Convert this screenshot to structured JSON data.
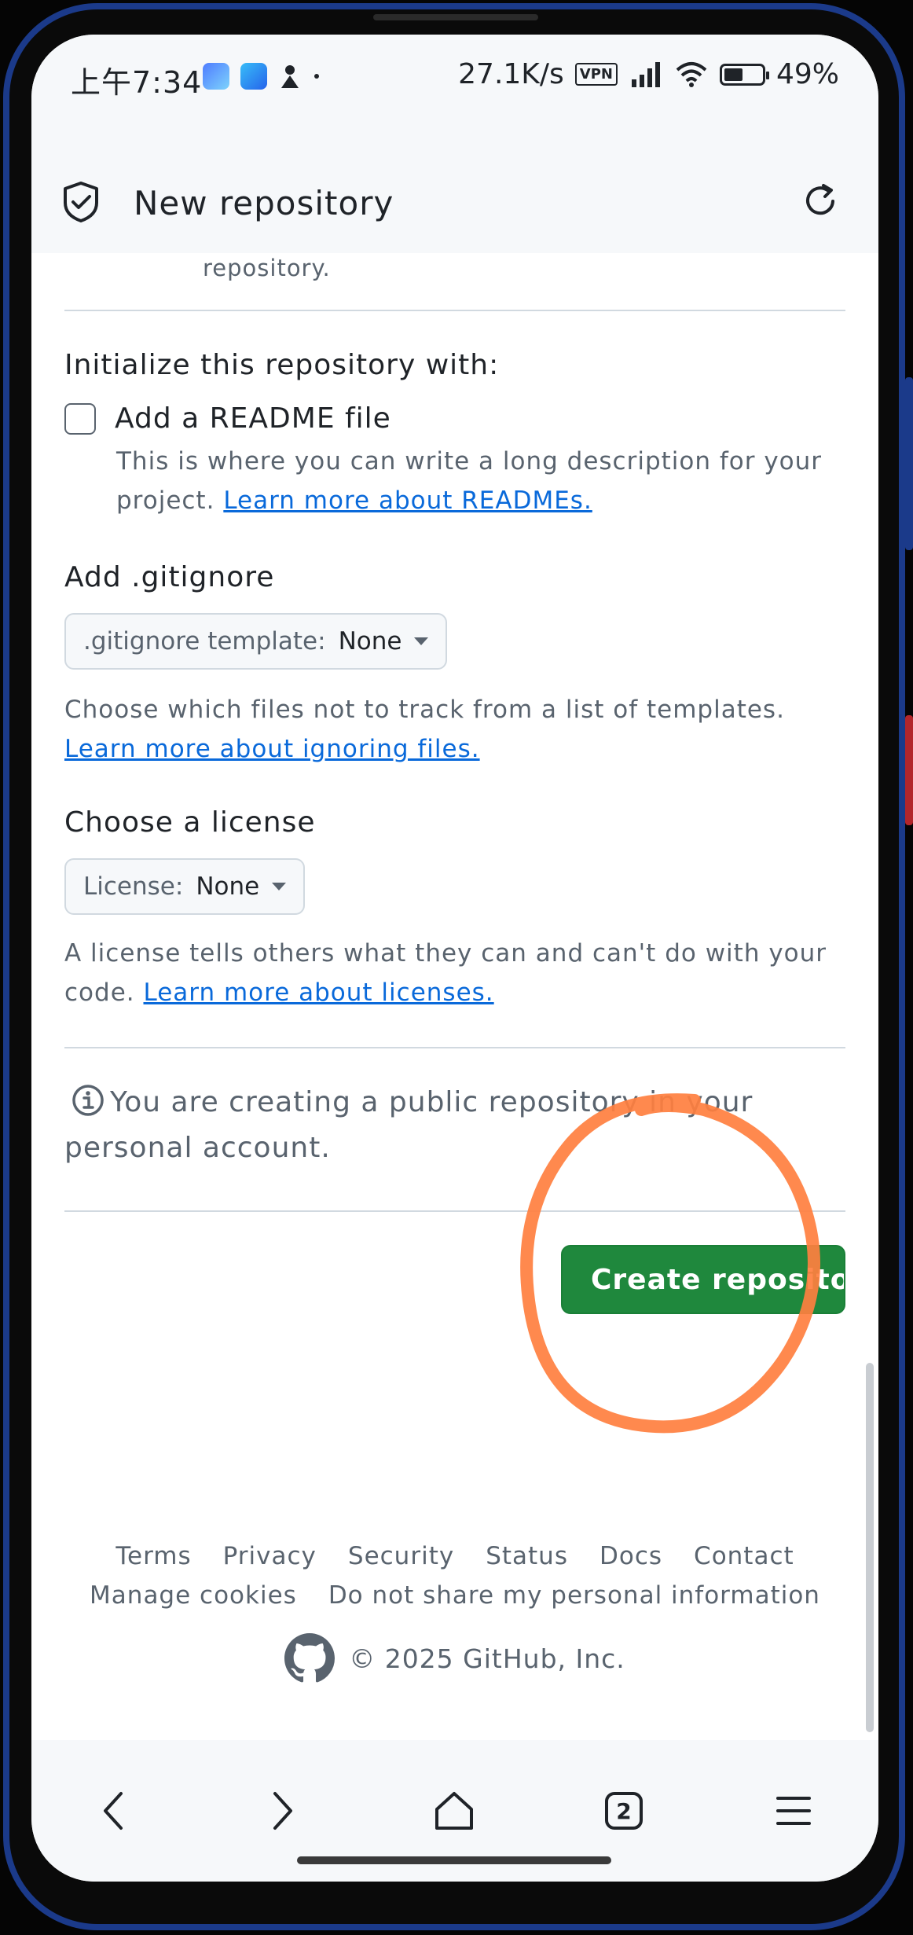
{
  "status_bar": {
    "time": "上午7:34",
    "net_speed": "27.1K/s",
    "vpn": "VPN",
    "battery": "49%",
    "battery_level": 0.49
  },
  "header": {
    "title": "New repository",
    "shield_icon": "shield-check-icon",
    "reload_icon": "reload-icon"
  },
  "content": {
    "top_fragment": "repository.",
    "init_title": "Initialize this repository with:",
    "readme": {
      "label": "Add a README file",
      "checked": false,
      "desc": "This is where you can write a long description for your project.",
      "link": "Learn more about READMEs."
    },
    "gitignore": {
      "title": "Add .gitignore",
      "select_label": ".gitignore template:",
      "select_value": "None",
      "desc": "Choose which files not to track from a list of templates.",
      "link": "Learn more about ignoring files."
    },
    "license": {
      "title": "Choose a license",
      "select_label": "License:",
      "select_value": "None",
      "desc": "A license tells others what they can and can't do with your code.",
      "link": "Learn more about licenses."
    },
    "notice": "You are creating a public repository in your personal account.",
    "create_button": "Create repository"
  },
  "footer": {
    "links_row1": [
      "Terms",
      "Privacy",
      "Security",
      "Status",
      "Docs",
      "Contact"
    ],
    "links_row2": [
      "Manage cookies",
      "Do not share my personal information"
    ],
    "copyright": "© 2025 GitHub, Inc."
  },
  "navbar": {
    "items": [
      "back-icon",
      "forward-icon",
      "home-icon",
      "tabs-icon",
      "menu-icon"
    ],
    "tabs_count": "2"
  },
  "colors": {
    "accent_green": "#1f883d",
    "link_blue": "#0969da",
    "annotation_orange": "#ff7f3f"
  }
}
